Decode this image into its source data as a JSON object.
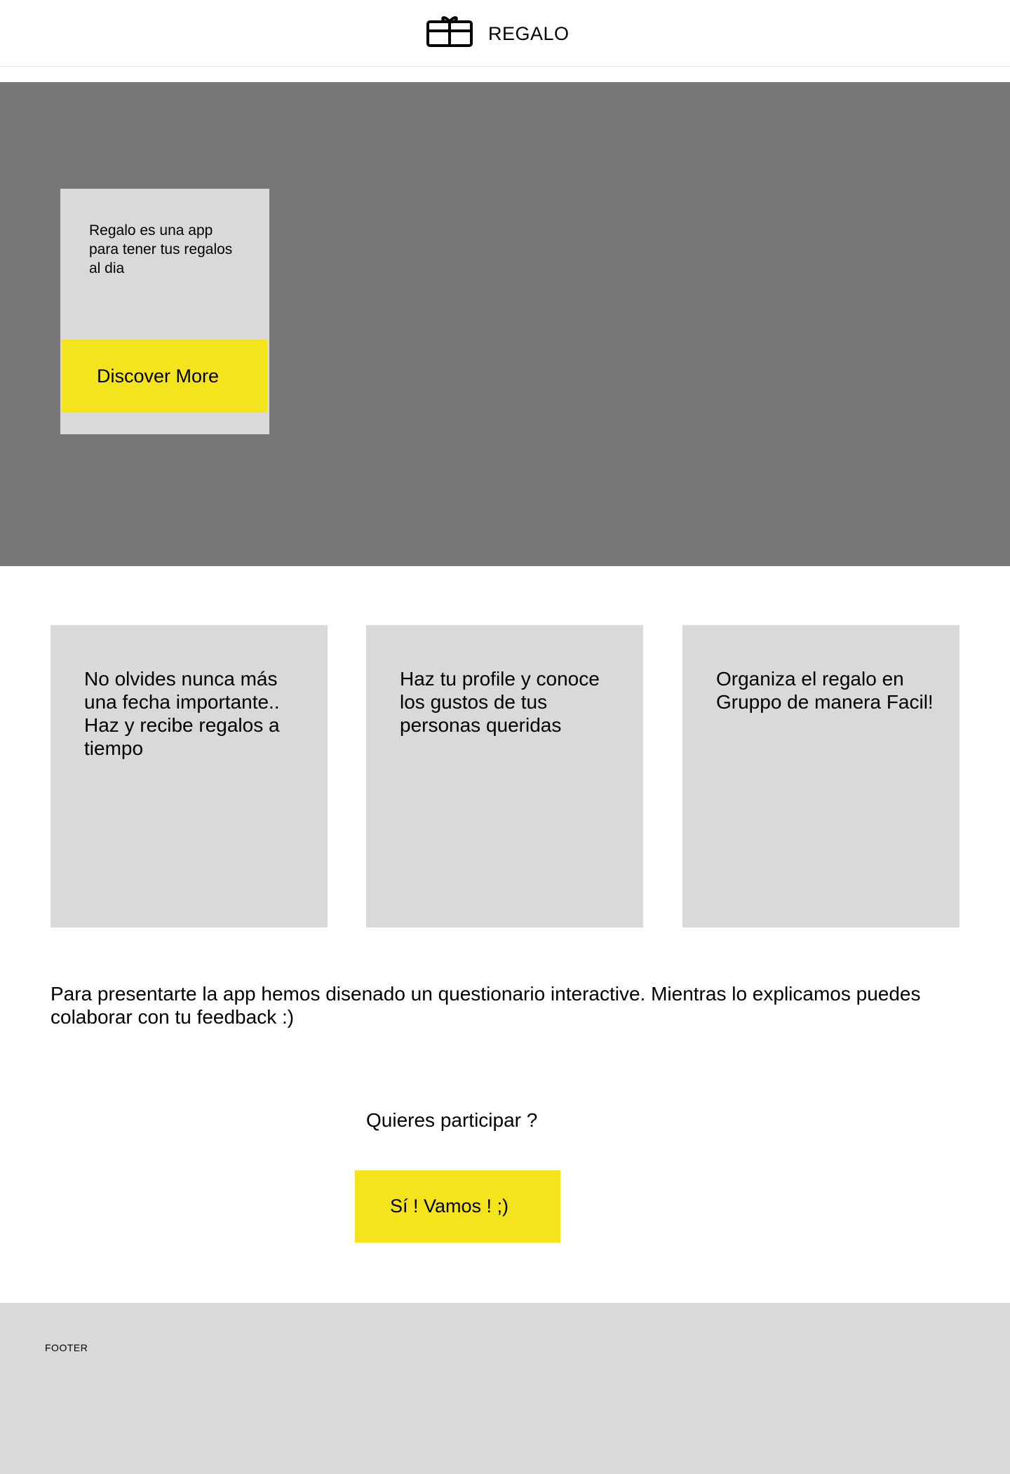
{
  "header": {
    "brand": "REGALO",
    "logo_icon": "gift-icon"
  },
  "hero": {
    "text": "Regalo es una app para tener tus regalos al dia",
    "button_label": "Discover More"
  },
  "features": [
    {
      "text": "No olvides nunca más una fecha importante.. Haz y recibe regalos a tiempo"
    },
    {
      "text": "Haz tu profile y conoce los gustos de tus personas queridas"
    },
    {
      "text": "Organiza el regalo en Gruppo de manera Facil!"
    }
  ],
  "intro": {
    "text": "Para presentarte la app hemos disenado un questionario interactive. Mientras lo explicamos puedes colaborar con tu feedback :)"
  },
  "participate": {
    "question": "Quieres participar ?",
    "button_label": "Sí ! Vamos ! ;)"
  },
  "footer": {
    "label": "FOOTER"
  },
  "colors": {
    "accent": "#f3e41e",
    "hero_bg": "#777777",
    "card_bg": "#d9d9d9",
    "footer_bg": "#d9d9d9"
  }
}
